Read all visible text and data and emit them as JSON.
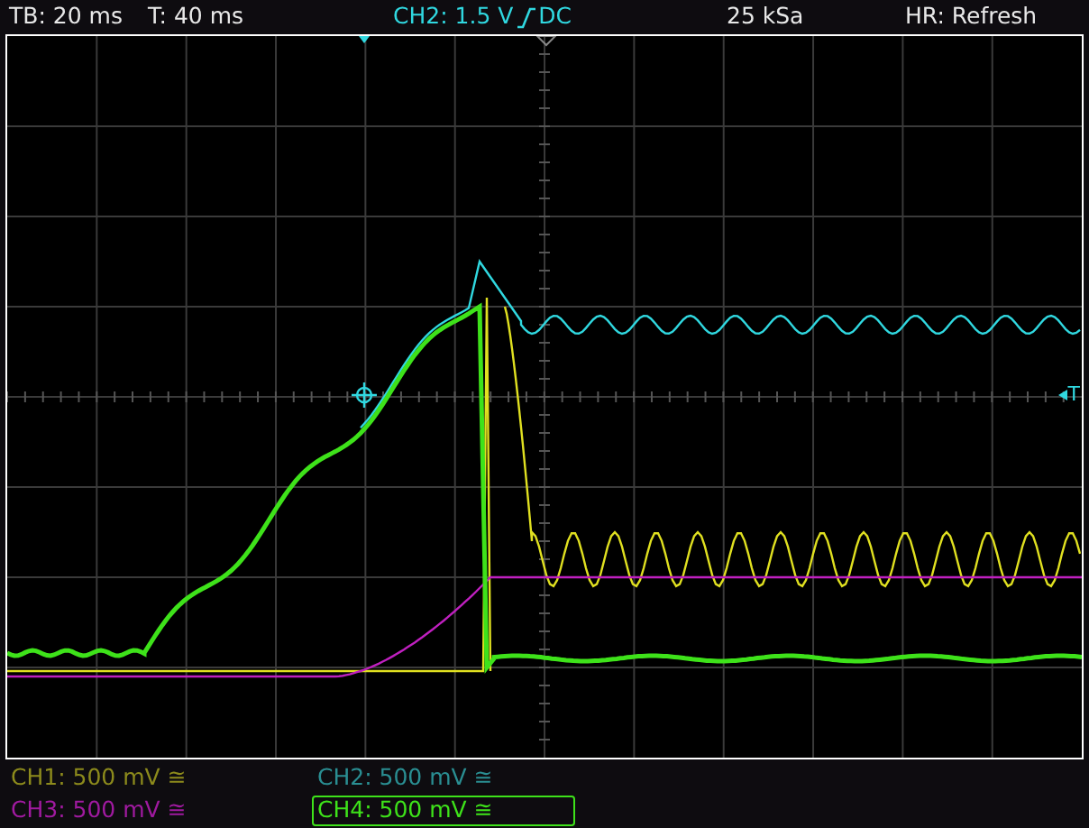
{
  "status_bar": {
    "timebase": "TB: 20 ms",
    "trigger_time": "T: 40 ms",
    "trigger_source_level": "CH2: 1.5 V",
    "trigger_coupling": "DC",
    "sample_rate": "25 kSa",
    "acquisition_mode": "HR: Refresh"
  },
  "trigger_level_marker": "T",
  "channels": [
    {
      "label": "CH1: 500 mV ≅",
      "color": "#8c8a1c",
      "selected": false
    },
    {
      "label": "CH2: 500 mV ≅",
      "color": "#2a8e92",
      "selected": false
    },
    {
      "label": "CH3: 500 mV ≅",
      "color": "#a01aa0",
      "selected": false
    },
    {
      "label": "CH4: 500 mV ≅",
      "color": "#3ee21a",
      "selected": true
    }
  ]
}
